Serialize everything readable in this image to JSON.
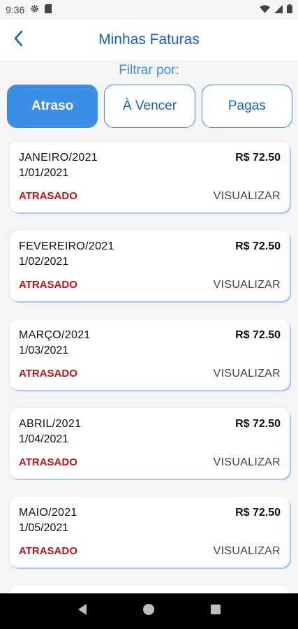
{
  "status_bar": {
    "time": "9:36",
    "icons": [
      "gear-icon",
      "sim-card-icon",
      "wifi-icon",
      "signal-icon",
      "battery-icon"
    ]
  },
  "header": {
    "title": "Minhas Faturas",
    "back_icon": "chevron-left-icon"
  },
  "filter": {
    "label": "Filtrar por:",
    "options": [
      {
        "label": "Atraso",
        "active": true
      },
      {
        "label": "À Vencer",
        "active": false
      },
      {
        "label": "Pagas",
        "active": false
      }
    ]
  },
  "invoices": [
    {
      "month": "JANEIRO/2021",
      "date": "1/01/2021",
      "amount": "R$ 72.50",
      "status": "ATRASADO",
      "action": "VISUALIZAR"
    },
    {
      "month": "FEVEREIRO/2021",
      "date": "1/02/2021",
      "amount": "R$ 72.50",
      "status": "ATRASADO",
      "action": "VISUALIZAR"
    },
    {
      "month": "MARÇO/2021",
      "date": "1/03/2021",
      "amount": "R$ 72.50",
      "status": "ATRASADO",
      "action": "VISUALIZAR"
    },
    {
      "month": "ABRIL/2021",
      "date": "1/04/2021",
      "amount": "R$ 72.50",
      "status": "ATRASADO",
      "action": "VISUALIZAR"
    },
    {
      "month": "MAIO/2021",
      "date": "1/05/2021",
      "amount": "R$ 72.50",
      "status": "ATRASADO",
      "action": "VISUALIZAR"
    }
  ],
  "nav_bar": {
    "buttons": [
      "back-triangle-icon",
      "home-circle-icon",
      "recents-square-icon"
    ]
  },
  "colors": {
    "accent": "#3b8de6",
    "title": "#1a5fc4",
    "overdue": "#c0141c"
  }
}
